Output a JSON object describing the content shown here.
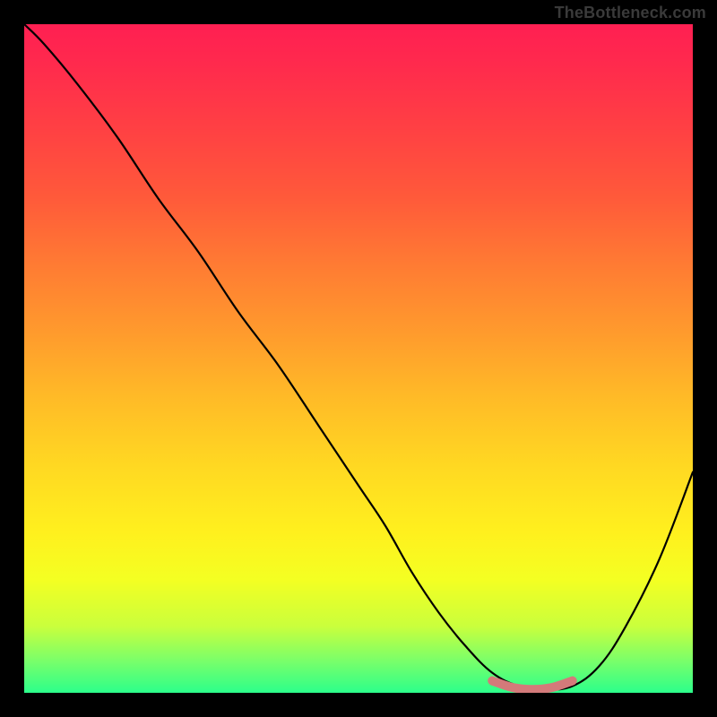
{
  "watermark": "TheBottleneck.com",
  "chart_data": {
    "type": "line",
    "title": "",
    "xlabel": "",
    "ylabel": "",
    "xlim": [
      0,
      100
    ],
    "ylim": [
      0,
      100
    ],
    "series": [
      {
        "name": "bottleneck-curve",
        "color": "#000000",
        "x": [
          0,
          3,
          8,
          14,
          20,
          26,
          32,
          38,
          44,
          50,
          54,
          58,
          62,
          66,
          70,
          74,
          78,
          82,
          86,
          90,
          95,
          100
        ],
        "values": [
          100,
          97,
          91,
          83,
          74,
          66,
          57,
          49,
          40,
          31,
          25,
          18,
          12,
          7,
          3,
          1,
          0.5,
          1,
          4,
          10,
          20,
          33
        ]
      },
      {
        "name": "optimal-band",
        "color": "#d47a7a",
        "x": [
          70,
          73,
          76,
          79,
          82
        ],
        "values": [
          1.8,
          0.8,
          0.5,
          0.8,
          1.8
        ]
      }
    ],
    "background_gradient": {
      "top": "#ff1f52",
      "bottom": "#2cff8b"
    }
  }
}
